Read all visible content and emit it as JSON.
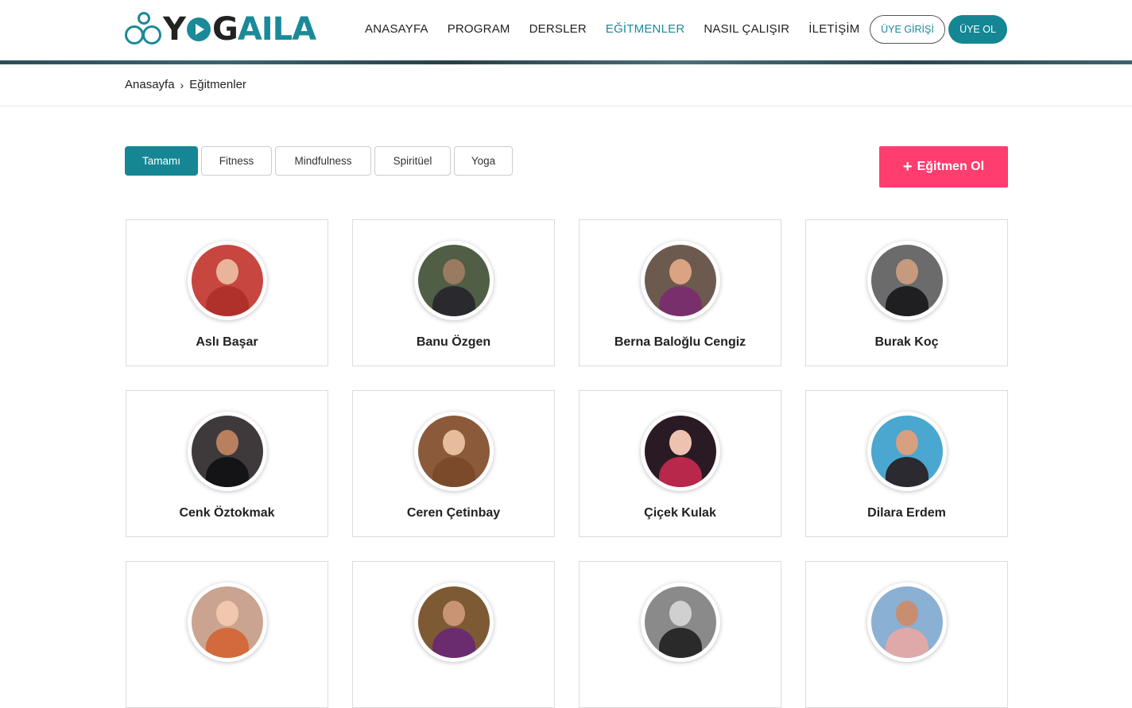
{
  "brand": {
    "logo_dark": "YOG",
    "logo_accent": "AILA",
    "color": "#1a8a99"
  },
  "nav": [
    {
      "label": "ANASAYFA",
      "active": false
    },
    {
      "label": "PROGRAM",
      "active": false
    },
    {
      "label": "DERSLER",
      "active": false
    },
    {
      "label": "EĞİTMENLER",
      "active": true
    },
    {
      "label": "NASIL ÇALIŞIR",
      "active": false
    },
    {
      "label": "İLETİŞİM",
      "active": false
    }
  ],
  "auth": {
    "login_label": "ÜYE GİRİŞİ",
    "signup_label": "ÜYE OL"
  },
  "breadcrumb": {
    "home": "Anasayfa",
    "current": "Eğitmenler"
  },
  "filters": [
    {
      "label": "Tamamı",
      "active": true
    },
    {
      "label": "Fitness",
      "active": false
    },
    {
      "label": "Mindfulness",
      "active": false
    },
    {
      "label": "Spiritüel",
      "active": false
    },
    {
      "label": "Yoga",
      "active": false
    }
  ],
  "cta": {
    "icon": "plus-icon",
    "label": "Eğitmen Ol",
    "color": "#ff3d6f"
  },
  "instructors": [
    {
      "name": "Aslı Başar",
      "bg": "#c7463f",
      "skin": "#e8b49a",
      "cloth": "#b0302c"
    },
    {
      "name": "Banu Özgen",
      "bg": "#4f5e45",
      "skin": "#9a7a60",
      "cloth": "#2a2a2e"
    },
    {
      "name": "Berna Baloğlu Cengiz",
      "bg": "#6d5a4e",
      "skin": "#d9a384",
      "cloth": "#7a2f6d"
    },
    {
      "name": "Burak Koç",
      "bg": "#6b6b6b",
      "skin": "#c69a7e",
      "cloth": "#1f1f22"
    },
    {
      "name": "Cenk Öztokmak",
      "bg": "#3e3a3c",
      "skin": "#b8805e",
      "cloth": "#141416"
    },
    {
      "name": "Ceren Çetinbay",
      "bg": "#8b5a3a",
      "skin": "#e6bd9c",
      "cloth": "#7a4a2a"
    },
    {
      "name": "Çiçek Kulak",
      "bg": "#2a1a24",
      "skin": "#eec2b0",
      "cloth": "#b8284a"
    },
    {
      "name": "Dilara Erdem",
      "bg": "#4aa7cf",
      "skin": "#d8a080",
      "cloth": "#2a2a30"
    },
    {
      "name": "",
      "bg": "#caa491",
      "skin": "#f1c8ae",
      "cloth": "#d36a3c"
    },
    {
      "name": "",
      "bg": "#7d5a34",
      "skin": "#c99474",
      "cloth": "#6a2c6e"
    },
    {
      "name": "",
      "bg": "#8a8a8a",
      "skin": "#d0d0d0",
      "cloth": "#2a2a2a"
    },
    {
      "name": "",
      "bg": "#8ab0d4",
      "skin": "#c98e70",
      "cloth": "#e0a9a9"
    }
  ]
}
